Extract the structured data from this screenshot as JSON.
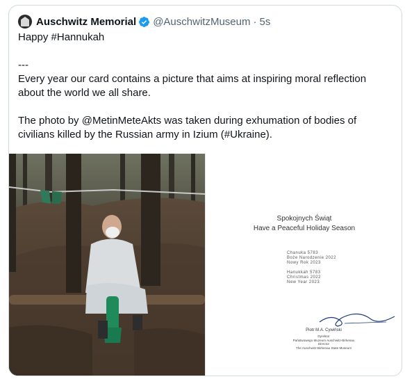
{
  "tweet": {
    "author_name": "Auschwitz Memorial",
    "handle": "@AuschwitzMuseum",
    "separator": "·",
    "time": "5s",
    "lines": [
      "Happy #Hannukah",
      "---",
      "Every year our card contains a picture that aims at inspiring moral reflection about the world we all share.",
      "The photo by @MetinMeteAkts was taken during exhumation of bodies of civilians killed by the Russian army in Izium (#Ukraine)."
    ]
  },
  "card": {
    "title_pl": "Spokojnych Świąt",
    "title_en": "Have a Peaceful Holiday Season",
    "dates_group1": [
      "Chanuka 5783",
      "Boże Narodzenie 2022",
      "Nowy Rok 2023"
    ],
    "dates_group2": [
      "Hanukkah 5783",
      "Christmas 2022",
      "New Year 2023"
    ],
    "signer_name": "Piotr M.A. Cywiński",
    "signer_roles": [
      "Dyrektor",
      "Państwowego Muzeum Auschwitz-Birkenau",
      "Director",
      "The Auschwitz-Birkenau State Museum"
    ]
  },
  "colors": {
    "verified_blue": "#1d9bf0",
    "text_primary": "#0f1419",
    "text_secondary": "#536471",
    "border": "#cfd9de"
  },
  "icons": {
    "verified": "verified-badge-icon",
    "avatar": "memorial-logo-avatar"
  }
}
